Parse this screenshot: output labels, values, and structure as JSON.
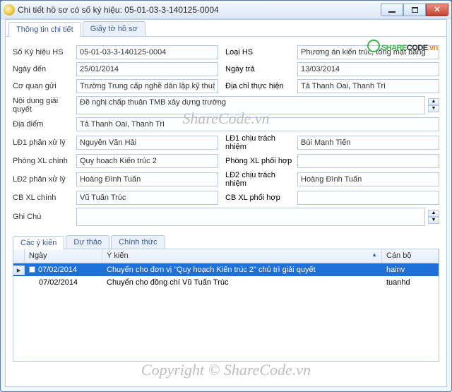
{
  "window": {
    "title": "Chi tiết hồ sơ có số ký hiệu: 05-01-03-3-140125-0004"
  },
  "brand": {
    "text1": "SHARE",
    "text2": "CODE",
    "suffix": ".vn"
  },
  "tabs": {
    "detail": "Thông tin chi tiết",
    "docs": "Giấy tờ hồ sơ"
  },
  "labels": {
    "so_ky_hieu": "Số Ký hiệu HS",
    "loai_hs": "Loại HS",
    "ngay_den": "Ngày đến",
    "ngay_tra": "Ngày trả",
    "co_quan_gui": "Cơ quan gửi",
    "dia_chi_th": "Địa chỉ thực hiện",
    "noi_dung": "Nội dung giải quyết",
    "dia_diem": "Địa điểm",
    "ld1_xl": "LĐ1 phân xử lý",
    "ld1_cn": "LĐ1 chịu trách nhiệm",
    "phong_xl": "Phòng XL chính",
    "phong_ph": "Phòng XL phối hợp",
    "ld2_xl": "LĐ2 phân xử lý",
    "ld2_cn": "LĐ2 chịu trách nhiệm",
    "cb_xl": "CB XL chính",
    "cb_ph": "CB XL phối hợp",
    "ghi_chu": "Ghi Chú"
  },
  "values": {
    "so_ky_hieu": "05-01-03-3-140125-0004",
    "loai_hs": "Phương án kiến trúc, tổng mặt bằng",
    "ngay_den": "25/01/2014",
    "ngay_tra": "13/03/2014",
    "co_quan_gui": "Trường Trung cấp nghề dân lập kỹ thuật tổng hợp Hà",
    "dia_chi_th": "Tả Thanh Oai, Thanh Trì",
    "noi_dung": "Đề nghị chấp thuận TMB xây dựng trường",
    "dia_diem": "Tả Thanh Oai, Thanh Trì",
    "ld1_xl": "Nguyễn Văn Hải",
    "ld1_cn": "Bùi Mạnh Tiến",
    "phong_xl": "Quy hoạch Kiến trúc 2",
    "phong_ph": "",
    "ld2_xl": "Hoàng Đình Tuấn",
    "ld2_cn": "Hoàng Đình Tuấn",
    "cb_xl": "Vũ Tuấn Trúc",
    "cb_ph": "",
    "ghi_chu": ""
  },
  "subtabs": {
    "opinions": "Các ý kiến",
    "draft": "Dự thảo",
    "official": "Chính thức"
  },
  "grid": {
    "cols": {
      "date": "Ngày",
      "opinion": "Ý kiến",
      "staff": "Cán bộ"
    },
    "rows": [
      {
        "date": "07/02/2014",
        "opinion": "Chuyển cho đơn vị \"Quy hoạch Kiến trúc 2\" chủ trì giải quyết",
        "staff": "hainv",
        "selected": true,
        "tree": "-"
      },
      {
        "date": "07/02/2014",
        "opinion": "Chuyển cho đồng chí Vũ Tuấn Trúc",
        "staff": "tuanhd",
        "selected": false,
        "tree": ""
      }
    ]
  },
  "watermark": {
    "wm1": "ShareCode.vn",
    "wm2": "Copyright © ShareCode.vn"
  }
}
